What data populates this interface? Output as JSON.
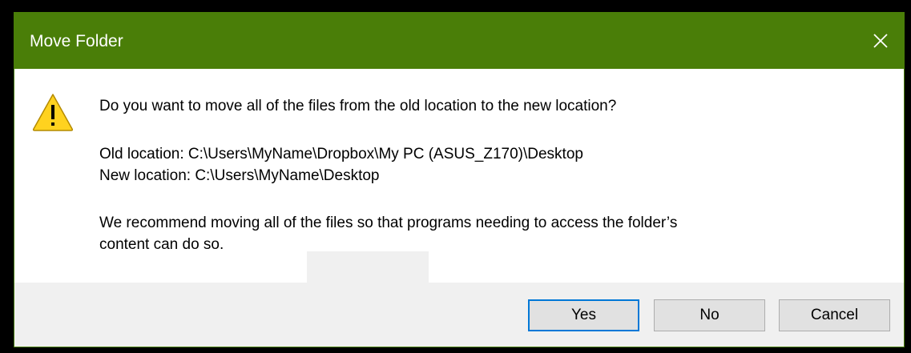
{
  "window": {
    "title": "Move Folder",
    "accent_color": "#4a7e08"
  },
  "icons": {
    "warning": "warning-icon",
    "close": "close-icon"
  },
  "message": {
    "question": "Do you want to move all of the files from the old location to the new location?",
    "old_location": "Old location: C:\\Users\\MyName\\Dropbox\\My PC (ASUS_Z170)\\Desktop",
    "new_location": "New location: C:\\Users\\MyName\\Desktop",
    "recommendation_line1": "We recommend moving all of the files so that programs needing to access the folder’s",
    "recommendation_line2": "content can do so."
  },
  "buttons": {
    "yes": "Yes",
    "no": "No",
    "cancel": "Cancel",
    "default": "yes"
  }
}
